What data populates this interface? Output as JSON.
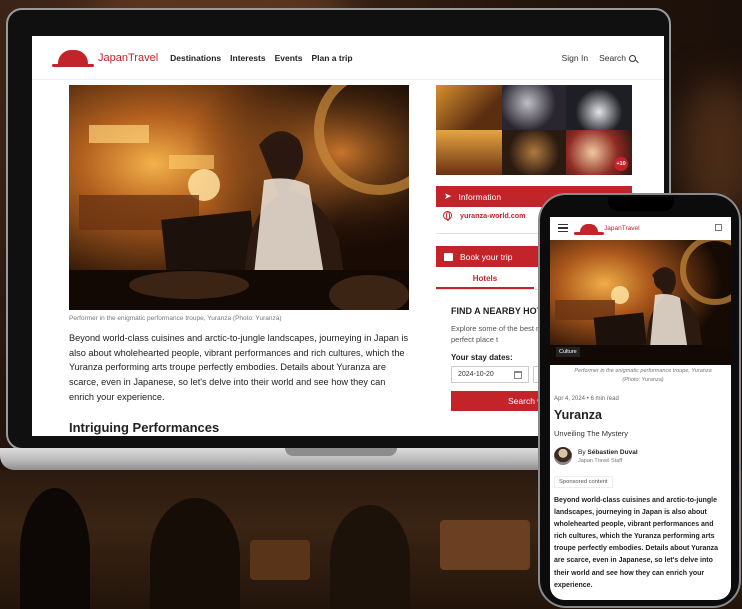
{
  "site": {
    "logo_brand": "Japan",
    "logo_suffix": "Travel"
  },
  "nav": {
    "links": [
      "Destinations",
      "Interests",
      "Events",
      "Plan a trip"
    ],
    "sign_in": "Sign In",
    "search": "Search"
  },
  "article": {
    "hero_caption": "Performer in the enigmatic performance troupe, Yuranza (Photo: Yuranza)",
    "intro": "Beyond world-class cuisines and arctic-to-jungle landscapes, journeying in Japan is also about wholehearted people, vibrant performances and rich cultures, which the Yuranza performing arts troupe perfectly embodies. Details about Yuranza are scarce, even in Japanese, so let's delve into their world and see how they can enrich your experience.",
    "section_heading": "Intriguing Performances"
  },
  "sidebar": {
    "gallery_count": "+10",
    "info_label": "Information",
    "website": "yuranza-world.com",
    "book_label": "Book your trip",
    "tab_hotels": "Hotels",
    "find_title": "FIND A NEARBY HOTE",
    "find_text": "Explore some of the best ne deals for the perfect place t",
    "stay_dates_label": "Your stay dates:",
    "checkin_date": "2024-10-20",
    "checkout_date": "2",
    "search_button": "Search with Trip"
  },
  "mobile": {
    "category_tag": "Culture",
    "hero_caption": "Performer in the enigmatic performance troupe, Yuranza (Photo: Yuranza)",
    "date_line": "Apr 4, 2024 • 6 min read",
    "title": "Yuranza",
    "subtitle": "Unveiling The Mystery",
    "by_prefix": "By",
    "author": "Sébastien Duval",
    "author_role": "Japan Travel Staff",
    "sponsored": "Sponsored content",
    "body": "Beyond world-class cuisines and arctic-to-jungle landscapes, journeying in Japan is also about wholehearted people, vibrant performances and rich cultures, which the Yuranza performing arts troupe perfectly embodies. Details about Yuranza are scarce, even in Japanese, so let's delve into their world and see how they can enrich your experience."
  },
  "colors": {
    "brand_red": "#c2242a",
    "scene_warm": "#e8a13a"
  }
}
